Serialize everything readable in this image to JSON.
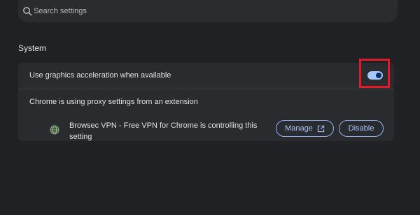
{
  "search": {
    "placeholder": "Search settings"
  },
  "section": {
    "title": "System"
  },
  "settings": {
    "graphics_acceleration": {
      "label": "Use graphics acceleration when available",
      "enabled": true
    },
    "proxy": {
      "label": "Chrome is using proxy settings from an extension",
      "extension_text": "Browsec VPN - Free VPN for Chrome is controlling this setting",
      "extension_icon": "globe-icon",
      "manage_label": "Manage",
      "disable_label": "Disable"
    }
  },
  "colors": {
    "background": "#202124",
    "card": "#2a2b2e",
    "accent": "#a8c7fa",
    "highlight": "#e01a2b"
  }
}
